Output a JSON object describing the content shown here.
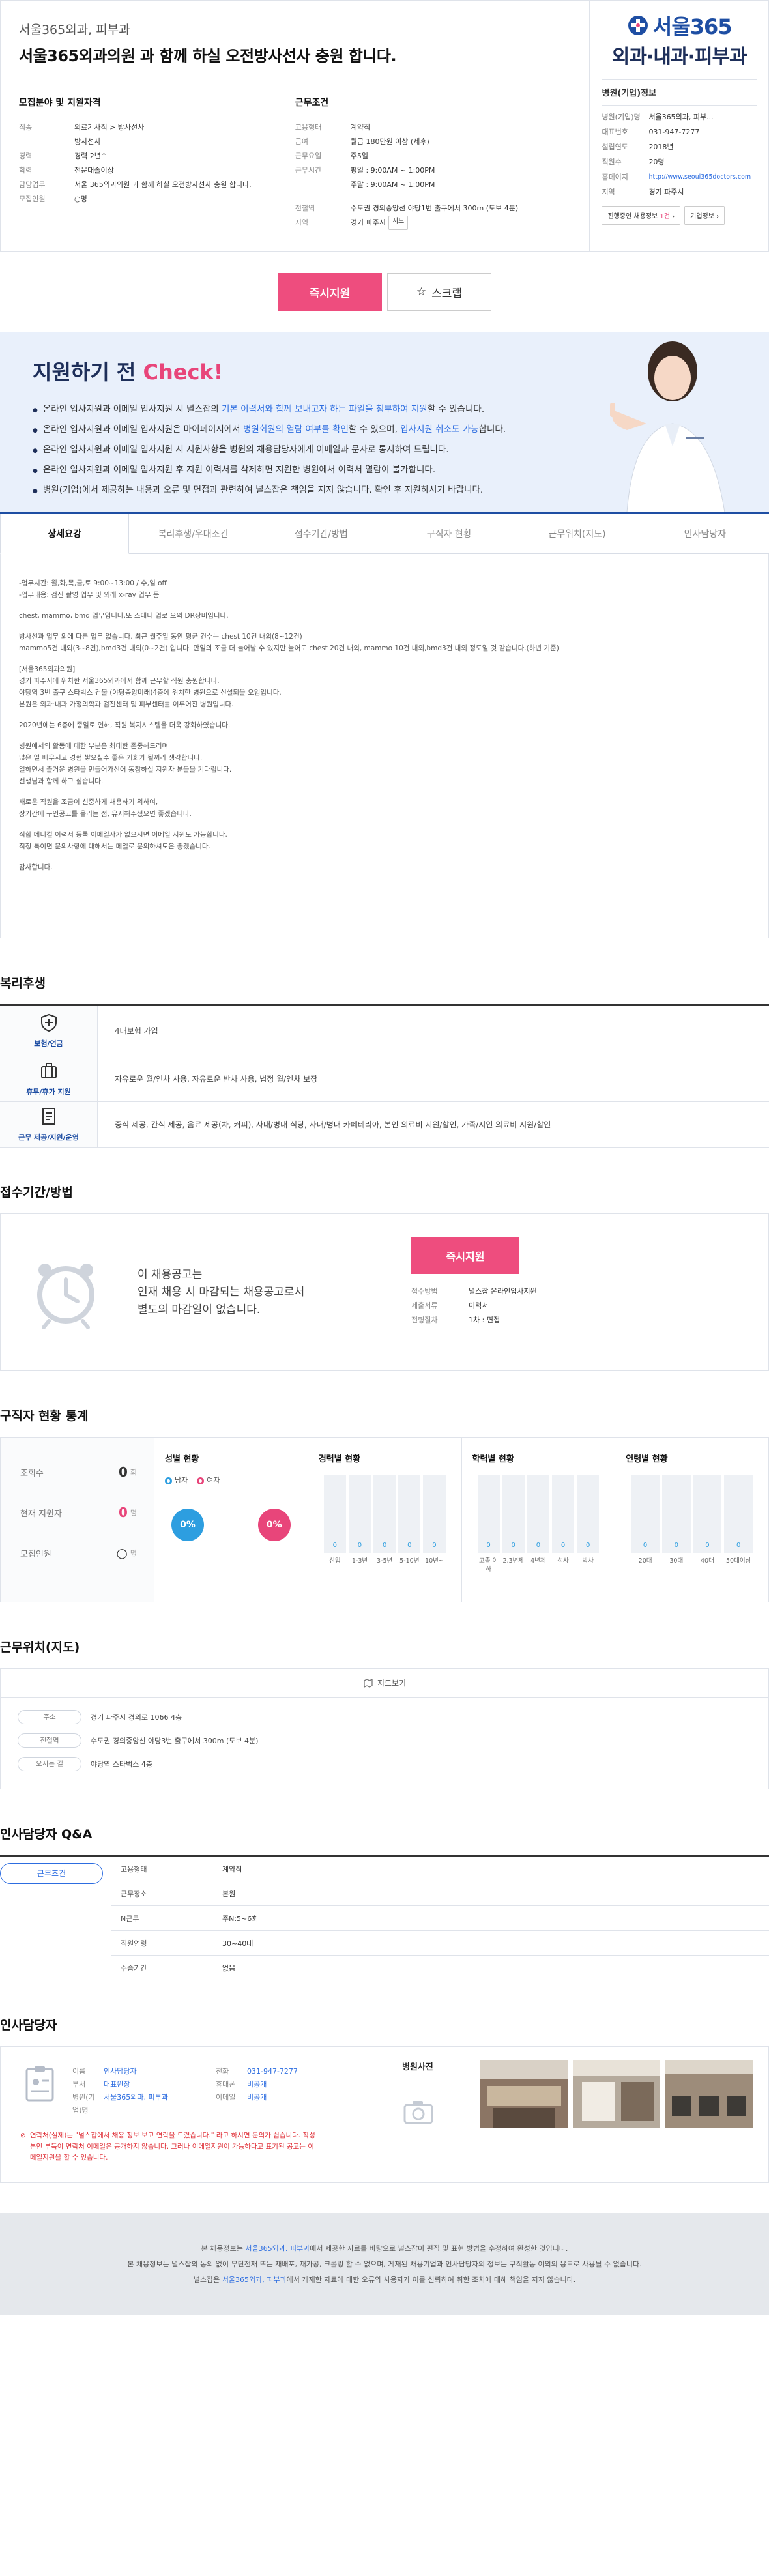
{
  "header": {
    "company_path": "서울365외과, 피부과",
    "title": "서울365외과의원 과 함께 하실 오전방사선사 충원 합니다."
  },
  "recruit": {
    "heading": "모집분야 및 지원자격",
    "rows": [
      {
        "k": "직종",
        "v": "의료기사직 > 방사선사"
      },
      {
        "k": "",
        "v": "방사선사"
      },
      {
        "k": "경력",
        "v": "경력 2년↑"
      },
      {
        "k": "학력",
        "v": "전문대졸이상"
      },
      {
        "k": "담당업무",
        "v": "서울 365외과의원 과 함께 하실 오전방사선사 충원 합니다."
      },
      {
        "k": "모집인원",
        "v": "○명"
      }
    ]
  },
  "work": {
    "heading": "근무조건",
    "rows": [
      {
        "k": "고용형태",
        "v": "계약직"
      },
      {
        "k": "급여",
        "v": "월급 180만원 이상 (세후)"
      },
      {
        "k": "근무요일",
        "v": "주5일"
      },
      {
        "k": "근무시간",
        "v": "평일 : 9:00AM ~ 1:00PM"
      },
      {
        "k": "",
        "v": "주말 : 9:00AM ~ 1:00PM"
      },
      {
        "k": "전철역",
        "v": "수도권 경의중앙선 야당1번 출구에서 300m (도보 4분)"
      },
      {
        "k": "지역",
        "v": "경기 파주시"
      }
    ],
    "map_btn": "지도",
    "station_line": "수도권 경의중앙선"
  },
  "company": {
    "logo_top": "서울365",
    "logo_bottom": "외과·내과·피부과",
    "title": "병원(기업)정보",
    "rows": [
      {
        "k": "병원(기업)명",
        "v": "서울365외과, 피부..."
      },
      {
        "k": "대표번호",
        "v": "031-947-7277"
      },
      {
        "k": "설립연도",
        "v": "2018년"
      },
      {
        "k": "직원수",
        "v": "20명"
      },
      {
        "k": "홈페이지",
        "v": "http://www.seoul365doctors.com"
      },
      {
        "k": "지역",
        "v": "경기 파주시"
      }
    ],
    "btn_jobs": "진행중인 채용정보",
    "btn_jobs_count": "1건",
    "btn_info": "기업정보"
  },
  "actions": {
    "apply": "즉시지원",
    "scrap": "스크랩"
  },
  "check": {
    "title_pre": "지원하기 전 ",
    "title_hl": "Check!",
    "items": [
      {
        "a": "온라인 입사지원과 이메일 입사지원 시 널스잡의 ",
        "b": "기본 이력서와 함께 보내고자 하는 파일을 첨부하여 지원",
        "c": "할 수 있습니다."
      },
      {
        "a": "온라인 입사지원과 이메일 입사지원은 마이페이지에서 ",
        "b": "병원회원의 열람 여부를 확인",
        "c": "할 수 있으며, ",
        "d": "입사지원 취소도 가능",
        "e": "합니다."
      },
      {
        "a": "온라인 입사지원과 이메일 입사지원 시 지원사항을 병원의 채용담당자에게 이메일과 문자로 통지하여 드립니다.",
        "b": "",
        "c": ""
      },
      {
        "a": "온라인 입사지원과 이메일 입사지원 후 지원 이력서를 삭제하면 지원한 병원에서 이력서 열람이 불가합니다.",
        "b": "",
        "c": ""
      },
      {
        "a": "병원(기업)에서 제공하는 내용과 오류 및 면접과 관련하여 널스잡은 책임을 지지 않습니다. 확인 후 지원하시기 바랍니다.",
        "b": "",
        "c": ""
      }
    ]
  },
  "tabs": [
    "상세요강",
    "복리후생/우대조건",
    "접수기간/방법",
    "구직자 현황",
    "근무위치(지도)",
    "인사담당자"
  ],
  "detail": [
    "-업무시간: 월,화,목,금,토 9:00~13:00 / 수,일 off",
    "-업무내용: 검진 촬영 업무 및 외래 x-ray 업무 등",
    "chest, mammo, bmd 업무입니다.또 스테디 업로 오의 DR장비입니다.",
    "방사선과 업무 외에 다른 업무 없습니다. 최근 월주일 동안 평균 건수는 chest 10건 내외(8~12건)",
    "mammo5건 내외(3~8건),bmd3건 내외(0~2건) 입니다. 만일의 조금 더 늘어날 수 있지만 늘어도 chest 20건 내외, mammo 10건 내외,bmd3건 내외 정도일 것 같습니다.(하년 기준)",
    "[서울365외과의원]",
    "경기 파주시에 위치한 서울365외과에서 함께 근무할 직원 충원합니다.",
    "야당역 3번 출구 스타벅스 건물 (야당중앙미래)4층에 위치한 병원으로 신설되을 오임입니다.",
    "본원은 외과·내과 가정의학과 검진센터 및 피부센터를 이루어진 병원입니다.",
    "2020년에는 6층에 종일로 인해, 직원 복지시스템을 더욱 강화하였습니다.",
    "병원에서의 활동에 대한 부분은 최대한 존중해드리며",
    "많은 일 배우시고 경험 쌓으실수 좋은 기회가 될꺼라 생각합니다.",
    "일하면서 즐거운 병원을 만들어가신어 동참하실 지원자 분들을 기다립니다.",
    "선생님과 함께 하고 싶습니다.",
    "새로운 직원을 조금이 신중하게 채용하기 위하여,",
    "장기간에 구인공고를 올리는 점, 유지해주셨으면 좋겠습니다.",
    "적합 메디컬 이력서 등록 이메일사가 없으시면 이메일 지원도 가능합니다.",
    "적정 특이면 문의사항에 대해서는 메일로 문의하셔도은 좋겠습니다.",
    "감사합니다."
  ],
  "welfare": {
    "title": "복리후생",
    "rows": [
      {
        "label": "보험/연금",
        "icon": "shield-icon",
        "value": "4대보험 가입"
      },
      {
        "label": "휴무/휴가 지원",
        "icon": "suitcase-icon",
        "value": "자유로운 월/연차 사용, 자유로운 반차 사용, 법정 월/연차 보장"
      },
      {
        "label": "근무 제공/지원/운영",
        "icon": "document-icon",
        "value": "중식 제공, 간식 제공, 음료 제공(차, 커피), 사내/병내 식당, 사내/병내 카페테리아, 본인 의료비 지원/할인, 가족/지인 의료비 지원/할인"
      }
    ]
  },
  "apply_method": {
    "title": "접수기간/방법",
    "msg": [
      "이 채용공고는",
      "인재 채용 시 마감되는 채용공고로서",
      "별도의 마감일이 없습니다."
    ],
    "btn": "즉시지원",
    "rows": [
      {
        "k": "접수방법",
        "v": "널스잡 온라인입사지원"
      },
      {
        "k": "제출서류",
        "v": "이력서"
      },
      {
        "k": "전형절차",
        "v": "1차 : 면접"
      }
    ]
  },
  "stats": {
    "title": "구직자 현황 통계",
    "left": [
      {
        "label": "조회수",
        "value": "0",
        "unit": "회"
      },
      {
        "label": "현재 지원자",
        "value": "0",
        "unit": "명"
      },
      {
        "label": "모집인원",
        "value": "○",
        "unit": "명"
      }
    ],
    "gender": {
      "title": "성별 현황",
      "male": "남자",
      "female": "여자",
      "male_pct": "0%",
      "female_pct": "0%"
    },
    "career": {
      "title": "경력별 현황",
      "labels": [
        "신입",
        "1-3년",
        "3-5년",
        "5-10년",
        "10년~"
      ],
      "values": [
        "0",
        "0",
        "0",
        "0",
        "0"
      ]
    },
    "edu": {
      "title": "학력별 현황",
      "labels": [
        "고졸 이하",
        "2,3년제",
        "4년제",
        "석사",
        "박사"
      ],
      "values": [
        "0",
        "0",
        "0",
        "0",
        "0"
      ]
    },
    "age": {
      "title": "연령별 현황",
      "labels": [
        "20대",
        "30대",
        "40대",
        "50대이상"
      ],
      "values": [
        "0",
        "0",
        "0",
        "0"
      ]
    }
  },
  "location": {
    "title": "근무위치(지도)",
    "map_label": "지도보기",
    "rows": [
      {
        "tag": "주소",
        "v": "경기 파주시 경의로 1066 4층"
      },
      {
        "tag": "전철역",
        "v": "수도권 경의중앙선 야당3번 출구에서 300m (도보 4분)"
      },
      {
        "tag": "오시는 길",
        "v": "야당역 스타벅스 4층"
      }
    ]
  },
  "qa": {
    "title": "인사담당자 Q&A",
    "tab": "근무조건",
    "rows": [
      {
        "k": "고용형태",
        "v": "계약직"
      },
      {
        "k": "근무장소",
        "v": "본원"
      },
      {
        "k": "N근무",
        "v": "주N:5~6회"
      },
      {
        "k": "직원연령",
        "v": "30~40대"
      },
      {
        "k": "수습기간",
        "v": "없음"
      }
    ]
  },
  "contact": {
    "title": "인사담당자",
    "col1": [
      {
        "k": "이름",
        "v": "인사담당자"
      },
      {
        "k": "부서",
        "v": "대표원장"
      },
      {
        "k": "병원(기업)명",
        "v": "서울365외과, 피부과"
      }
    ],
    "col2": [
      {
        "k": "전화",
        "v": "031-947-7277"
      },
      {
        "k": "휴대폰",
        "v": "비공개"
      },
      {
        "k": "이메일",
        "v": "비공개"
      }
    ],
    "note": "연락처(실제)는 \"널스잡에서 채용 정보 보고 연락을 드렸습니다.\" 라고 하시면 문의가 쉽습니다. 작성 본인 부득이 연락처 이메일은 공개하지 않습니다. 그러나 이메일지원이 가능하다고 표기된 공고는 이메일지원을 할 수 있습니다.",
    "photo_title": "병원사진"
  },
  "footer": {
    "line1_pre": "본 채용정보는 ",
    "line1_hl": "서울365외과, 피부과",
    "line1_post": "에서 제공한 자료를 바탕으로 널스잡이 편집 및 표현 방법을 수정하여 완성한 것입니다.",
    "line2": "본 채용정보는 널스잡의 동의 없이 무단전재 또는 재배포, 재가공, 크롤링 할 수 없으며, 게재된 채용기업과 인사담당자의 정보는 구직활동 이외의 용도로 사용될 수 없습니다.",
    "line3_pre": "널스잡은 ",
    "line3_hl": "서울365외과, 피부과",
    "line3_post": "에서 게재한 자료에 대한 오류와 사용자가 이를 신뢰하여 취한 조치에 대해 책임을 지지 않습니다."
  }
}
